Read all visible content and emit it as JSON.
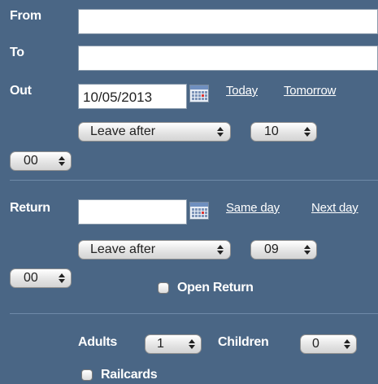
{
  "from": {
    "label": "From",
    "value": ""
  },
  "to": {
    "label": "To",
    "value": ""
  },
  "out": {
    "label": "Out",
    "date": "10/05/2013",
    "link_today": "Today",
    "link_tomorrow": "Tomorrow",
    "time_mode": "Leave after",
    "hour": "10",
    "minute": "00"
  },
  "return": {
    "label": "Return",
    "date": "",
    "link_same_day": "Same day",
    "link_next_day": "Next day",
    "time_mode": "Leave after",
    "hour": "09",
    "minute": "00",
    "open_return_label": "Open Return",
    "open_return_checked": false
  },
  "passengers": {
    "adults_label": "Adults",
    "adults_value": "1",
    "children_label": "Children",
    "children_value": "0",
    "railcards_label": "Railcards",
    "railcards_checked": false
  },
  "colors": {
    "background": "#4a6685",
    "label": "#ffffff",
    "divider": "#6f8aa8"
  },
  "icons": {
    "calendar": "calendar-icon",
    "select_arrows": "up-down-arrows-icon"
  }
}
